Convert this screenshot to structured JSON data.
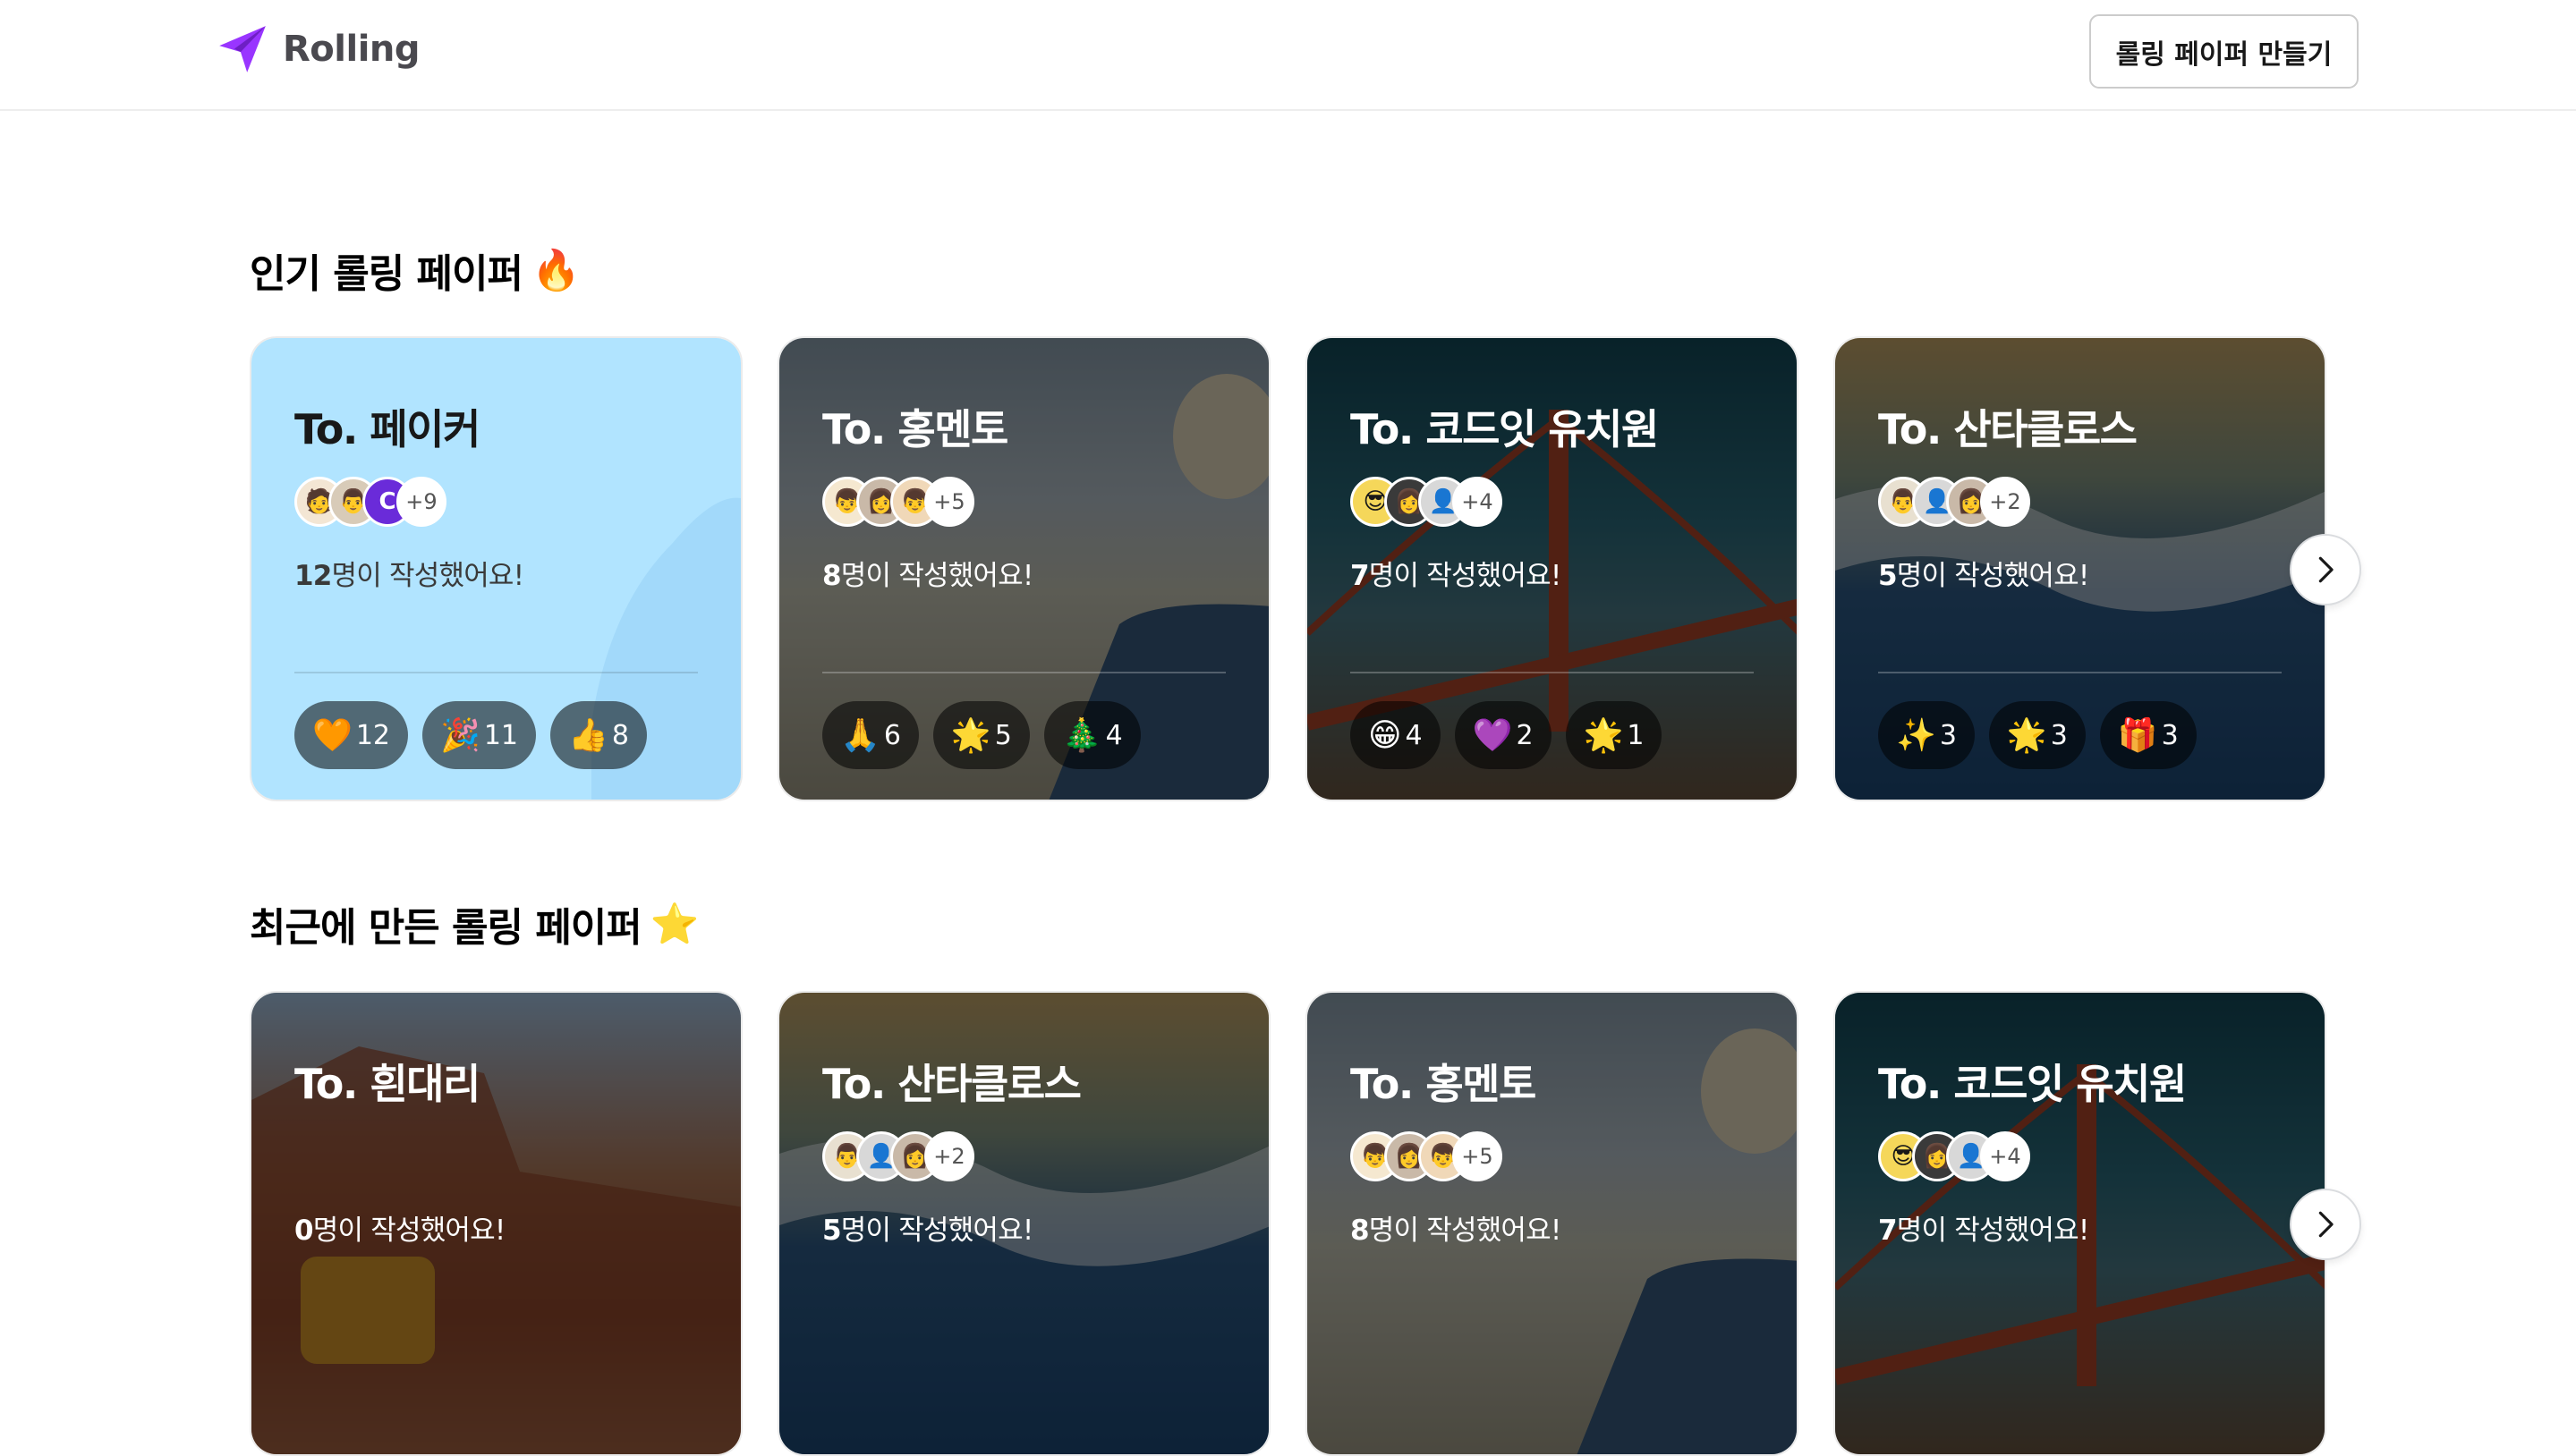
{
  "header": {
    "logo_text": "Rolling",
    "create_button": "롤링 페이퍼 만들기"
  },
  "popular": {
    "title": "인기 롤링 페이퍼",
    "title_emoji": "🔥",
    "cards": [
      {
        "to": "To. 페이커",
        "avatar_emojis": [
          "🧑",
          "👨",
          "C"
        ],
        "avatar_more": "+9",
        "count": "12",
        "count_suffix": "명이 작성했어요!",
        "reactions": [
          {
            "emoji": "🧡",
            "count": "12"
          },
          {
            "emoji": "🎉",
            "count": "11"
          },
          {
            "emoji": "👍",
            "count": "8"
          }
        ]
      },
      {
        "to": "To. 홍멘토",
        "avatar_emojis": [
          "👦",
          "👩",
          "👦"
        ],
        "avatar_more": "+5",
        "count": "8",
        "count_suffix": "명이 작성했어요!",
        "reactions": [
          {
            "emoji": "🙏",
            "count": "6"
          },
          {
            "emoji": "🌟",
            "count": "5"
          },
          {
            "emoji": "🎄",
            "count": "4"
          }
        ]
      },
      {
        "to": "To. 코드잇 유치원",
        "avatar_emojis": [
          "😎",
          "👩",
          "👤"
        ],
        "avatar_more": "+4",
        "count": "7",
        "count_suffix": "명이 작성했어요!",
        "reactions": [
          {
            "emoji": "😁",
            "count": "4"
          },
          {
            "emoji": "💜",
            "count": "2"
          },
          {
            "emoji": "🌟",
            "count": "1"
          }
        ]
      },
      {
        "to": "To. 산타클로스",
        "avatar_emojis": [
          "👨",
          "👤",
          "👩"
        ],
        "avatar_more": "+2",
        "count": "5",
        "count_suffix": "명이 작성했어요!",
        "reactions": [
          {
            "emoji": "✨",
            "count": "3"
          },
          {
            "emoji": "🌟",
            "count": "3"
          },
          {
            "emoji": "🎁",
            "count": "3"
          }
        ]
      }
    ]
  },
  "recent": {
    "title": "최근에 만든 롤링 페이퍼",
    "title_emoji": "⭐",
    "cards": [
      {
        "to": "To. 흰대리",
        "count": "0",
        "count_suffix": "명이 작성했어요!"
      },
      {
        "to": "To. 산타클로스",
        "avatar_emojis": [
          "👨",
          "👤",
          "👩"
        ],
        "avatar_more": "+2",
        "count": "5",
        "count_suffix": "명이 작성했어요!"
      },
      {
        "to": "To. 홍멘토",
        "avatar_emojis": [
          "👦",
          "👩",
          "👦"
        ],
        "avatar_more": "+5",
        "count": "8",
        "count_suffix": "명이 작성했어요!"
      },
      {
        "to": "To. 코드잇 유치원",
        "avatar_emojis": [
          "😎",
          "👩",
          "👤"
        ],
        "avatar_more": "+4",
        "count": "7",
        "count_suffix": "명이 작성했어요!"
      }
    ]
  },
  "colors": {
    "brand": "#9935ff",
    "card_blue": "#b1e4ff"
  },
  "icons": {
    "logo": "paper-plane-icon",
    "next": "chevron-right-icon"
  }
}
